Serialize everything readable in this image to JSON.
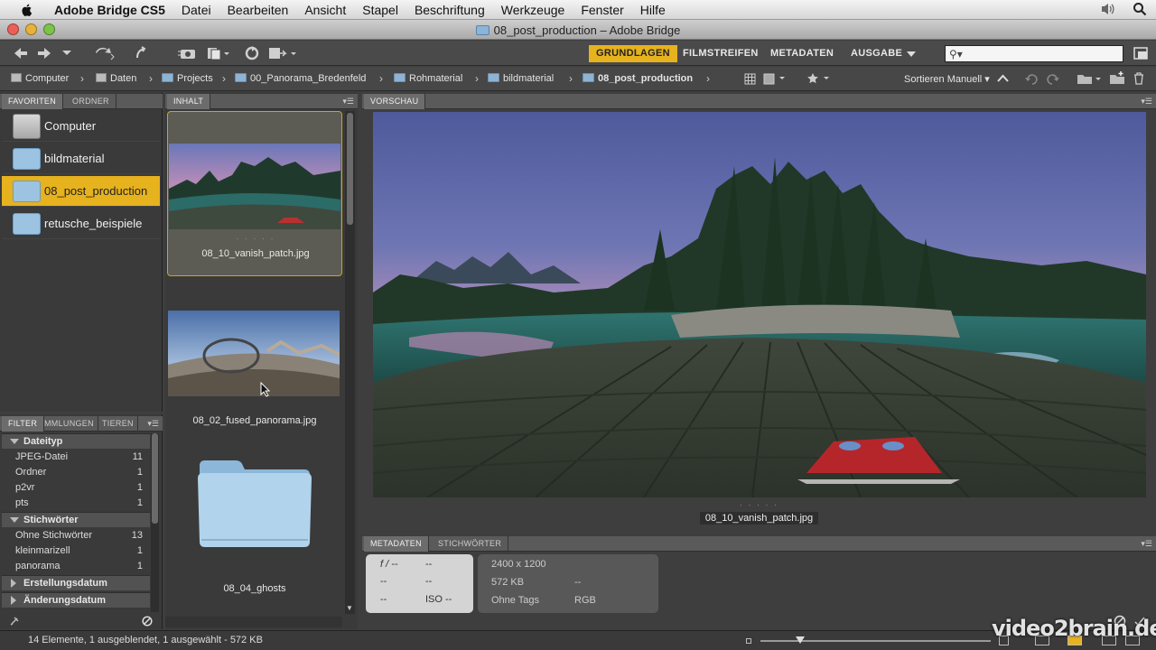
{
  "menubar": {
    "app": "Adobe Bridge CS5",
    "items": [
      "Datei",
      "Bearbeiten",
      "Ansicht",
      "Stapel",
      "Beschriftung",
      "Werkzeuge",
      "Fenster",
      "Hilfe"
    ]
  },
  "window": {
    "title": "08_post_production – Adobe Bridge"
  },
  "workspaces": {
    "grundlagen": "GRUNDLAGEN",
    "filmstreifen": "FILMSTREIFEN",
    "metadaten": "METADATEN",
    "ausgabe": "AUSGABE"
  },
  "search": {
    "value": ""
  },
  "path": [
    "Computer",
    "Daten",
    "Projects",
    "00_Panorama_Bredenfeld",
    "Rohmaterial",
    "bildmaterial",
    "08_post_production"
  ],
  "sort": {
    "label": "Sortieren Manuell"
  },
  "left_tabs": {
    "favoriten": "FAVORITEN",
    "ordner": "ORDNER"
  },
  "favorites": [
    "Computer",
    "bildmaterial",
    "08_post_production",
    "retusche_beispiele"
  ],
  "filter_tabs": {
    "filter": "FILTER",
    "sammlungen": "MMLUNGEN",
    "export": "TIEREN"
  },
  "filter": {
    "groups": [
      {
        "name": "Dateityp",
        "rows": [
          {
            "label": "JPEG-Datei",
            "count": "11"
          },
          {
            "label": "Ordner",
            "count": "1"
          },
          {
            "label": "p2vr",
            "count": "1"
          },
          {
            "label": "pts",
            "count": "1"
          }
        ]
      },
      {
        "name": "Stichwörter",
        "rows": [
          {
            "label": "Ohne Stichwörter",
            "count": "13"
          },
          {
            "label": "kleinmarizell",
            "count": "1"
          },
          {
            "label": "panorama",
            "count": "1"
          }
        ]
      },
      {
        "name": "Erstellungsdatum"
      },
      {
        "name": "Änderungsdatum"
      }
    ]
  },
  "content": {
    "tab": "INHALT",
    "items": [
      {
        "name": "08_10_vanish_patch.jpg",
        "dots": "· · · · ·"
      },
      {
        "name": "08_02_fused_panorama.jpg"
      },
      {
        "name": "08_04_ghosts"
      }
    ]
  },
  "preview": {
    "tab": "VORSCHAU",
    "caption": "08_10_vanish_patch.jpg",
    "dots": "· · · · ·"
  },
  "meta": {
    "tabs": {
      "metadaten": "METADATEN",
      "stichwoerter": "STICHWÖRTER"
    },
    "camera": {
      "fstop": "f / --",
      "shutter": "--",
      "r2a": "--",
      "r2b": "--",
      "r3a": "--",
      "iso": "ISO --"
    },
    "file": {
      "dims": "2400 x 1200",
      "size": "572 KB",
      "size2": "--",
      "tags": "Ohne Tags",
      "mode": "RGB"
    }
  },
  "status": {
    "text": "14 Elemente, 1 ausgeblendet, 1 ausgewählt - 572 KB"
  },
  "watermark": "video2brain.de",
  "colors": {
    "accent": "#e6b21e",
    "panel": "#3e3e3e"
  }
}
